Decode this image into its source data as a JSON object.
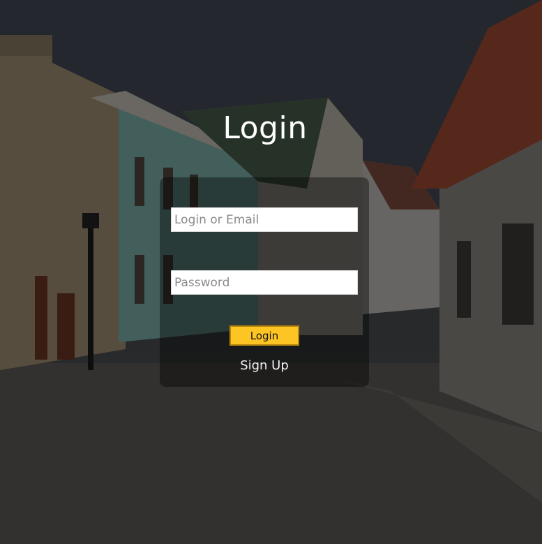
{
  "page": {
    "title": "Login",
    "accent_color": "#fdc524"
  },
  "form": {
    "login_placeholder": "Login or Email",
    "password_placeholder": "Password",
    "login_button": "Login",
    "signup_link": "Sign Up"
  }
}
